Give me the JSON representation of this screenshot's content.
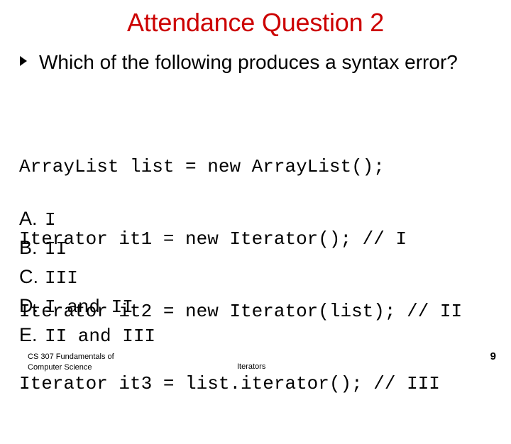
{
  "slide": {
    "title": "Attendance Question 2",
    "title_color": "#cc0000",
    "text_color": "#000000",
    "background": "#ffffff"
  },
  "question": {
    "bullet_icon": "triangle-right-bullet-icon",
    "text": "Which of the following produces a syntax error?"
  },
  "code": {
    "lines": [
      "ArrayList list = new ArrayList();",
      "Iterator it1 = new Iterator(); // I",
      "Iterator it2 = new Iterator(list); // II",
      "Iterator it3 = list.iterator(); // III"
    ]
  },
  "options": [
    {
      "label": "A.",
      "value": "I"
    },
    {
      "label": "B.",
      "value": "II"
    },
    {
      "label": "C.",
      "value": "III"
    },
    {
      "label": "D.",
      "value": "I and II"
    },
    {
      "label": "E.",
      "value": "II and III"
    }
  ],
  "footer": {
    "course_line1": "CS 307 Fundamentals of",
    "course_line2": "Computer Science",
    "topic": "Iterators",
    "page_number": "9"
  }
}
